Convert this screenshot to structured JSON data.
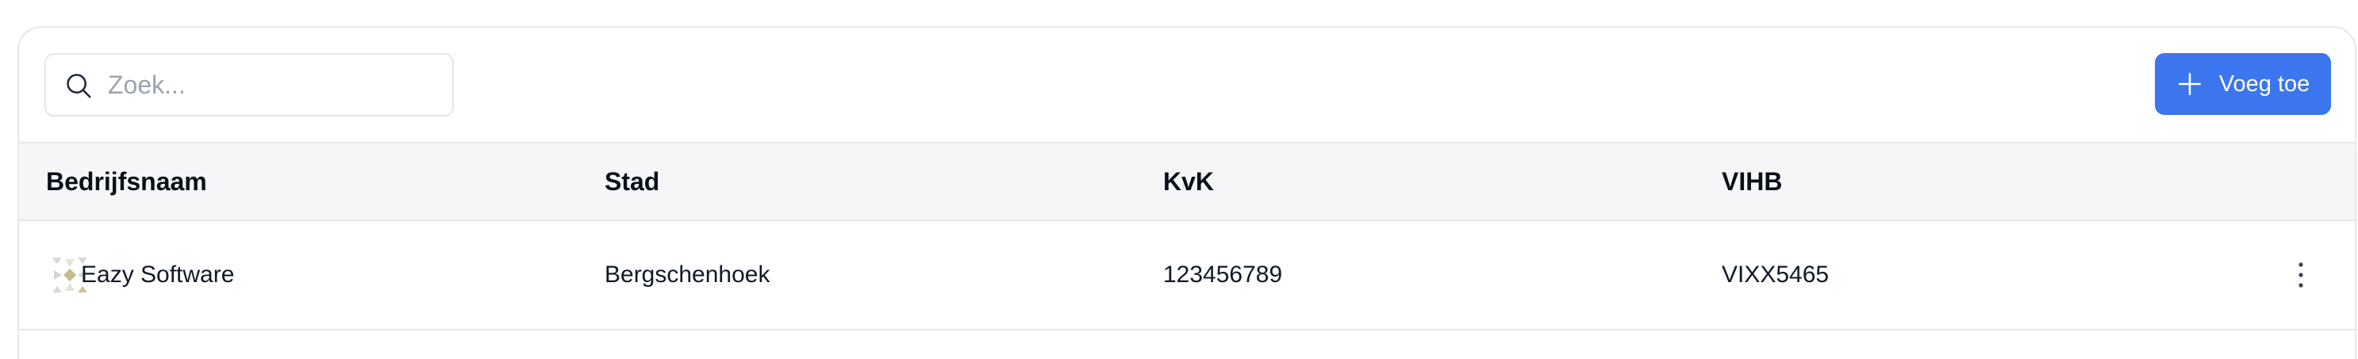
{
  "search": {
    "placeholder": "Zoek..."
  },
  "toolbar": {
    "add_label": "Voeg toe",
    "accent": "#3b76ee"
  },
  "table": {
    "columns": [
      "Bedrijfsnaam",
      "Stad",
      "KvK",
      "VIHB"
    ],
    "rows": [
      {
        "logo_icon": "company-logo-icon",
        "name": "Eazy Software",
        "city": "Bergschenhoek",
        "kvk": "123456789",
        "vihb": "VIXX5465",
        "actions_icon": "more-vertical-icon"
      }
    ]
  }
}
